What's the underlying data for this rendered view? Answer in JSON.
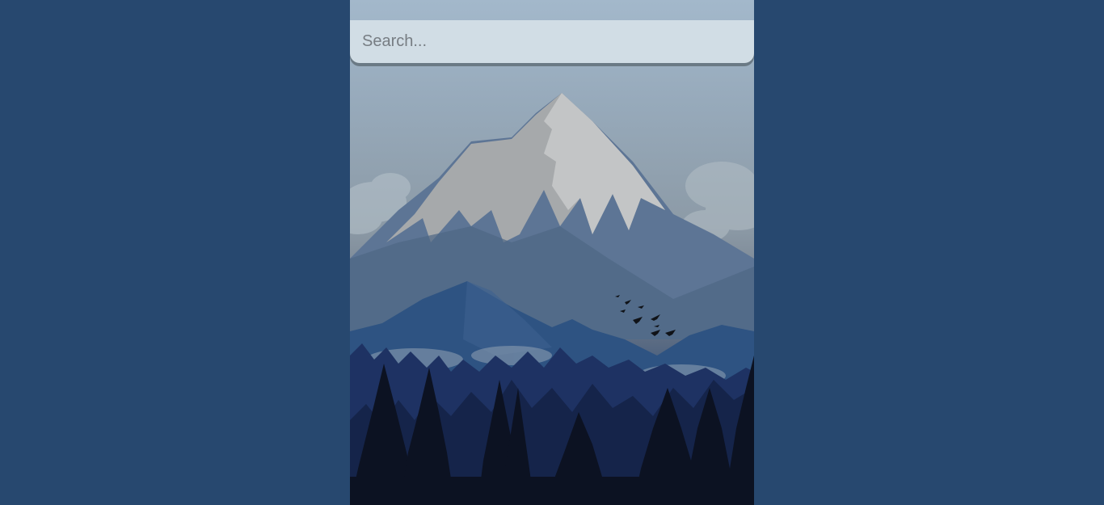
{
  "search": {
    "placeholder": "Search..."
  },
  "background": {
    "image": "mountain-forest-landscape",
    "page_color": "#27486f"
  }
}
